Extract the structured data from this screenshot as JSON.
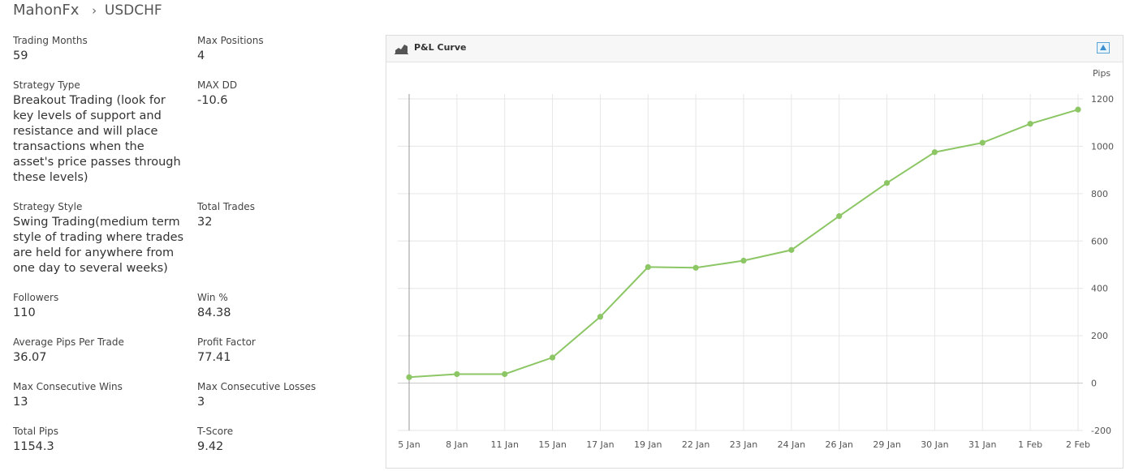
{
  "header": {
    "name": "MahonFx",
    "separator": "›",
    "symbol": "USDCHF"
  },
  "stats": [
    {
      "label": "Trading Months",
      "value": "59"
    },
    {
      "label": "Max Positions",
      "value": "4"
    },
    {
      "label": "Strategy Type",
      "value": "Breakout Trading (look for key levels of support and resistance and will place transactions when the asset's price passes through these levels)"
    },
    {
      "label": "MAX DD",
      "value": "-10.6"
    },
    {
      "label": "Strategy Style",
      "value": "Swing Trading(medium term style of trading where trades are held for anywhere from one day to several weeks)"
    },
    {
      "label": "Total Trades",
      "value": "32"
    },
    {
      "label": "Followers",
      "value": "110"
    },
    {
      "label": "Win %",
      "value": "84.38"
    },
    {
      "label": "Average Pips Per Trade",
      "value": "36.07"
    },
    {
      "label": "Profit Factor",
      "value": "77.41"
    },
    {
      "label": "Max Consecutive Wins",
      "value": "13"
    },
    {
      "label": "Max Consecutive Losses",
      "value": "3"
    },
    {
      "label": "Total Pips",
      "value": "1154.3"
    },
    {
      "label": "T-Score",
      "value": "9.42"
    }
  ],
  "panel": {
    "title": "P&L Curve",
    "icon": "area-chart-icon",
    "collapse_icon": "collapse-up-icon"
  },
  "chart_data": {
    "type": "line",
    "categories": [
      "5 Jan",
      "8 Jan",
      "11 Jan",
      "15 Jan",
      "17 Jan",
      "19 Jan",
      "22 Jan",
      "23 Jan",
      "24 Jan",
      "26 Jan",
      "29 Jan",
      "30 Jan",
      "31 Jan",
      "1 Feb",
      "2 Feb"
    ],
    "series": [
      {
        "values": [
          25,
          38,
          38,
          108,
          280,
          490,
          487,
          517,
          562,
          705,
          845,
          975,
          1015,
          1095,
          1155
        ]
      }
    ],
    "ylabel": "Pips",
    "ylim": [
      -200,
      1200
    ],
    "yticks": [
      1200,
      1000,
      800,
      600,
      400,
      200,
      0,
      -200
    ],
    "y_axis_side": "right",
    "grid": true,
    "line_color": "#8cc665"
  }
}
